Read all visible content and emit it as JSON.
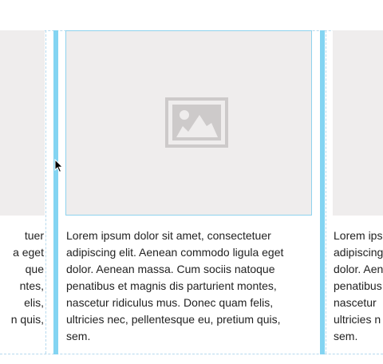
{
  "cards": {
    "left": {
      "caption_lines": [
        "tuer",
        "a eget",
        "que",
        "ntes,",
        "elis,",
        "n quis,"
      ]
    },
    "center": {
      "caption_lines": [
        "Lorem ipsum dolor sit amet, consectetuer",
        "adipiscing elit. Aenean commodo ligula eget",
        "dolor. Aenean massa. Cum sociis natoque",
        "penatibus et magnis dis parturient montes,",
        "nascetur ridiculus mus. Donec quam felis,",
        "ultricies nec, pellentesque eu, pretium quis,",
        "sem."
      ],
      "image_icon": "image-placeholder-icon"
    },
    "right": {
      "caption_lines": [
        "Lorem ips",
        "adipiscing",
        "dolor. Aen",
        "penatibus",
        "nascetur",
        "ultricies n",
        "sem."
      ]
    }
  },
  "colors": {
    "gutter": "#83d4f2",
    "placeholder_bg": "#efeded",
    "selected_border": "#8fd3ee",
    "icon": "#cdcaca"
  }
}
